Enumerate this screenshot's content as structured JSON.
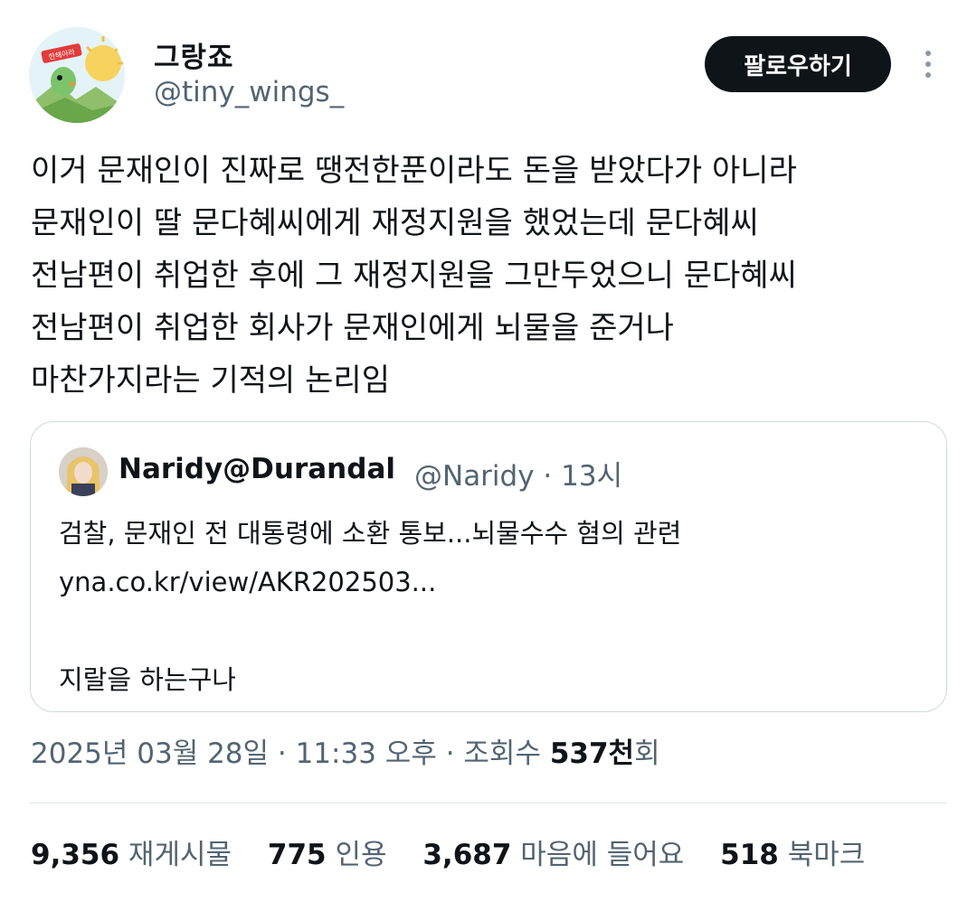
{
  "author": {
    "display_name": "그랑죠",
    "handle": "@tiny_wings_",
    "avatar_badge": "한해아라"
  },
  "follow_button": "팔로우하기",
  "tweet_lines": [
    "이거 문재인이 진짜로 땡전한푼이라도 돈을 받았다가 아니라",
    "문재인이 딸 문다혜씨에게 재정지원을 했었는데 문다혜씨",
    "전남편이 취업한 후에 그 재정지원을 그만두었으니 문다혜씨",
    "전남편이 취업한 회사가 문재인에게 뇌물을 준거나",
    "마찬가지라는 기적의 논리임"
  ],
  "quote": {
    "display_name": "Naridy@Durandal",
    "handle_time": "@Naridy · 13시",
    "lines": [
      "검찰, 문재인 전 대통령에 소환 통보...뇌물수수 혐의 관련",
      "yna.co.kr/view/AKR202503...",
      "",
      "지랄을 하는구나"
    ]
  },
  "meta": {
    "date_time": "2025년 03월 28일 · 11:33 오후 · 조회수 ",
    "views": "537천",
    "views_suffix": "회"
  },
  "stats": {
    "retweets": "9,356",
    "retweets_label": "재게시물",
    "quotes": "775",
    "quotes_label": "인용",
    "likes": "3,687",
    "likes_label": "마음에 들어요",
    "bookmarks": "518",
    "bookmarks_label": "북마크"
  },
  "colors": {
    "text": "#0f1419",
    "secondary": "#536471",
    "border": "#cfd9de"
  }
}
